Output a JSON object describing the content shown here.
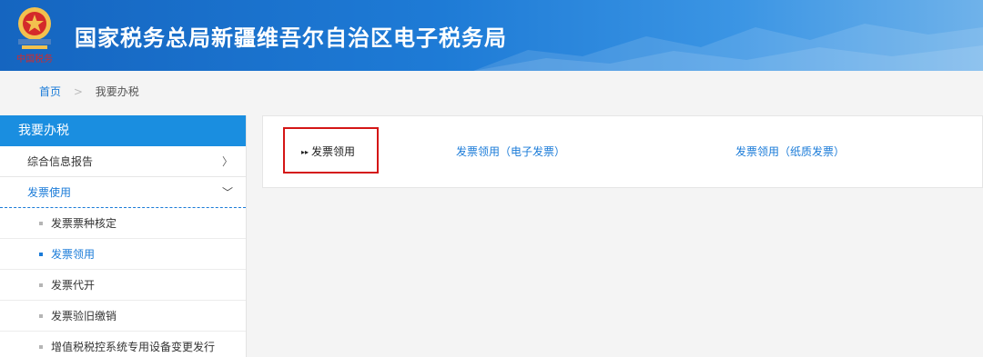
{
  "header": {
    "title": "国家税务总局新疆维吾尔自治区电子税务局",
    "logo_text": "中国税务"
  },
  "breadcrumb": {
    "home": "首页",
    "separator": ">",
    "current": "我要办税"
  },
  "sidebar": {
    "title": "我要办税",
    "items": [
      {
        "label": "综合信息报告",
        "arrow": "〉"
      },
      {
        "label": "发票使用",
        "arrow": "﹀"
      }
    ],
    "subitems": [
      {
        "label": "发票票种核定"
      },
      {
        "label": "发票领用"
      },
      {
        "label": "发票代开"
      },
      {
        "label": "发票验旧缴销"
      },
      {
        "label": "增值税税控系统专用设备变更发行"
      }
    ]
  },
  "panel": {
    "current_bullet": "▸▸",
    "current": "发票领用",
    "links": [
      "发票领用（电子发票）",
      "发票领用（纸质发票）"
    ]
  },
  "colors": {
    "brand": "#1a8ee0",
    "link": "#1a7bd8",
    "highlight": "#d41616"
  }
}
